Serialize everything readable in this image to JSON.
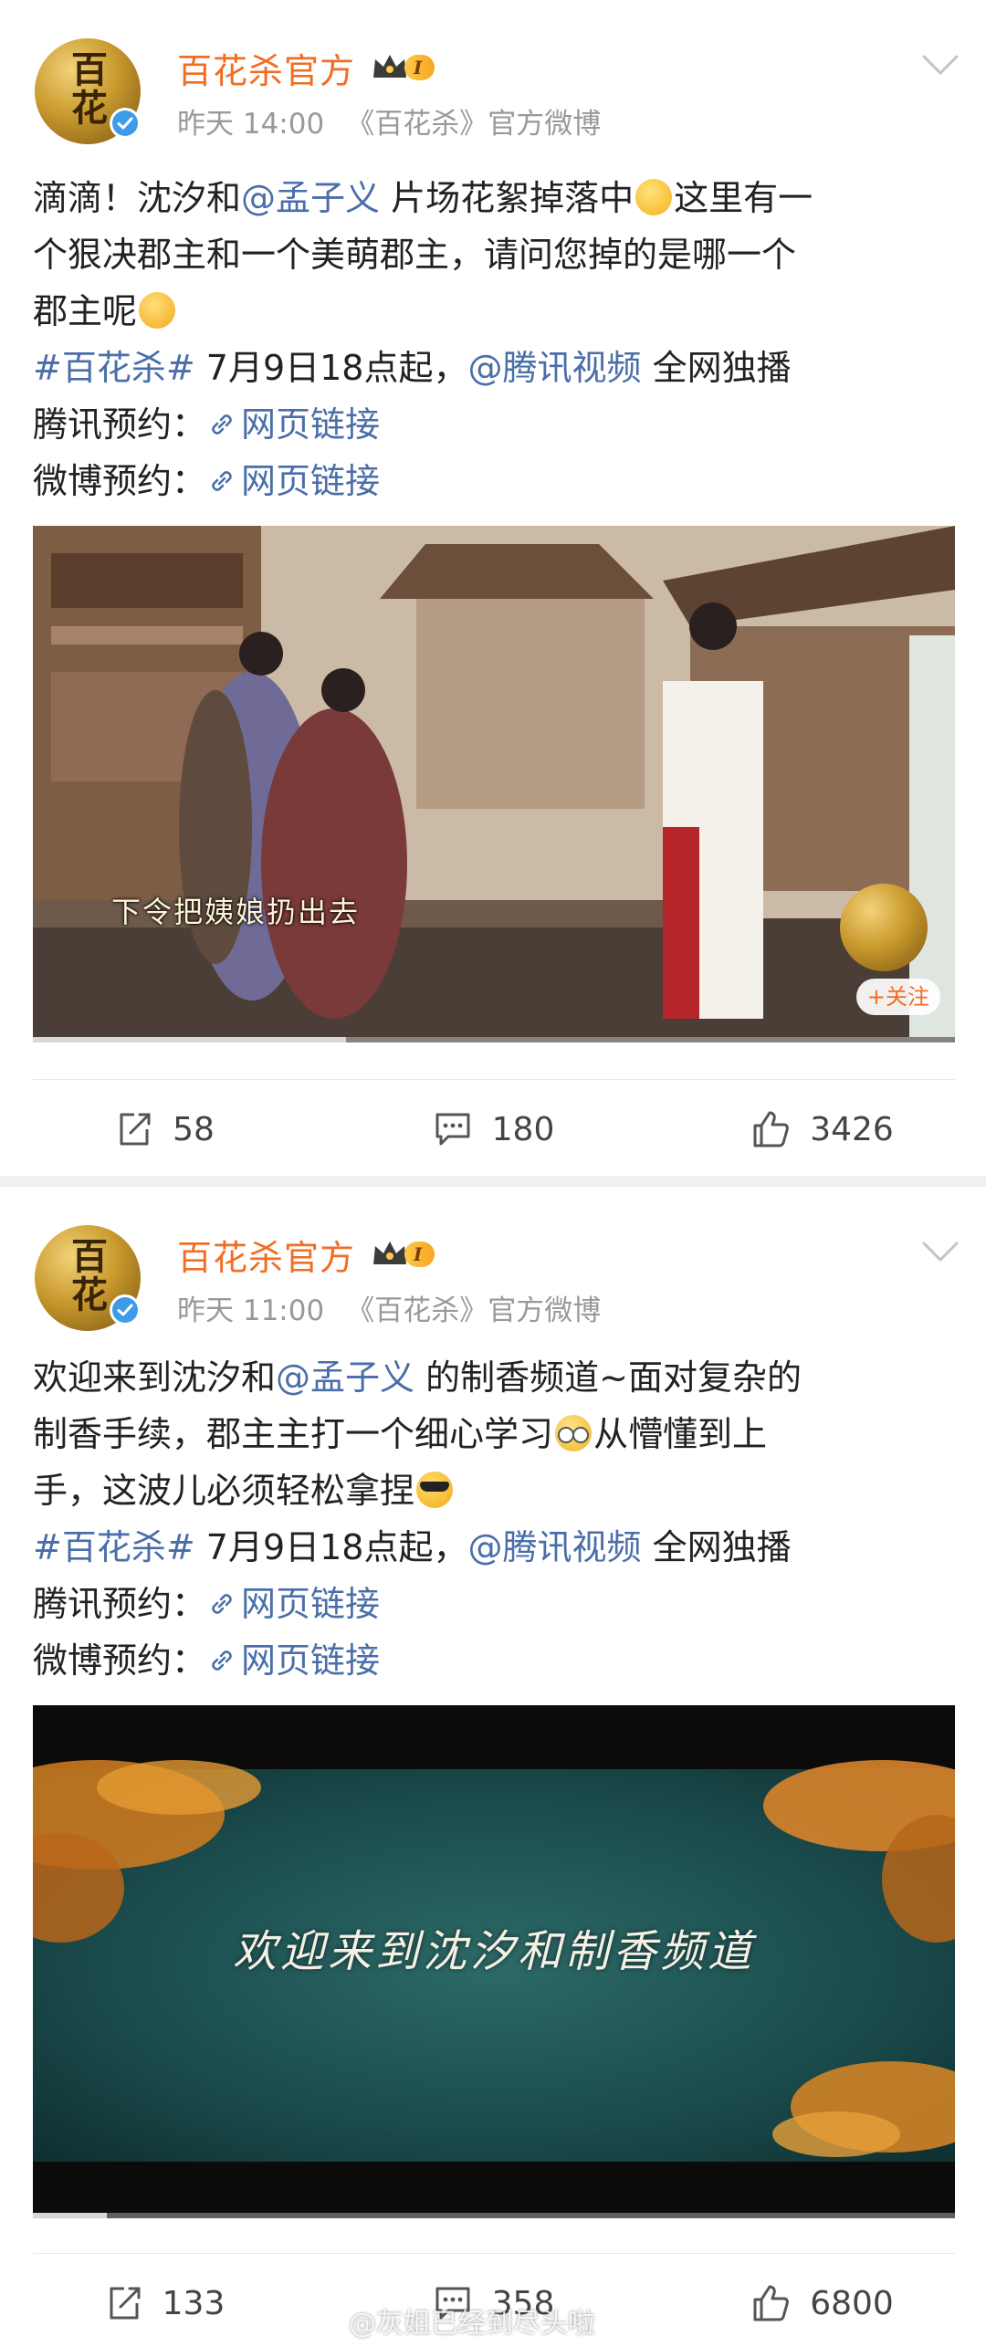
{
  "posts": [
    {
      "author": "百花杀官方",
      "level_badge": "I",
      "time": "昨天 14:00",
      "source": "《百花杀》官方微博",
      "text": {
        "l1_a": "滴滴！沈汐和",
        "l1_mention": "@孟子义",
        "l1_b": " 片场花絮掉落中",
        "l1_c": "这里有一",
        "l2": "个狠决郡主和一个美萌郡主，请问您掉的是哪一个",
        "l3": "郡主呢",
        "topic": "#百花杀#",
        "topic_after": " 7月9日18点起，",
        "platform_mention": "@腾讯视频",
        "platform_after": " 全网独播",
        "tencent_label": "腾讯预约：",
        "weibo_label": "微博预约：",
        "link_label": "网页链接"
      },
      "media": {
        "subtitle": "下令把姨娘扔出去",
        "follow": "+关注"
      },
      "actions": {
        "reposts": "58",
        "comments": "180",
        "likes": "3426"
      }
    },
    {
      "author": "百花杀官方",
      "level_badge": "I",
      "time": "昨天 11:00",
      "source": "《百花杀》官方微博",
      "text": {
        "l1_a": "欢迎来到沈汐和",
        "l1_mention": "@孟子义",
        "l1_b": " 的制香频道~面对复杂的",
        "l2_a": "制香手续，郡主主打一个细心学习",
        "l2_b": "从懵懂到上",
        "l3": "手，这波儿必须轻松拿捏",
        "topic": "#百花杀#",
        "topic_after": " 7月9日18点起，",
        "platform_mention": "@腾讯视频",
        "platform_after": " 全网独播",
        "tencent_label": "腾讯预约：",
        "weibo_label": "微博预约：",
        "link_label": "网页链接"
      },
      "media": {
        "title": "欢迎来到沈汐和制香频道",
        "progress": 0.08
      },
      "actions": {
        "reposts": "133",
        "comments": "358",
        "likes": "6800"
      }
    }
  ],
  "watermark": "@灰姐已经到尽头啦",
  "colors": {
    "author": "#f26d21",
    "link": "#4a6ea9",
    "meta": "#999999",
    "verified": "#f5a623"
  },
  "icons": [
    "avatar-logo",
    "verified-icon",
    "crown-icon",
    "chevron-down-icon",
    "link-icon",
    "repost-icon",
    "comment-icon",
    "like-icon"
  ]
}
